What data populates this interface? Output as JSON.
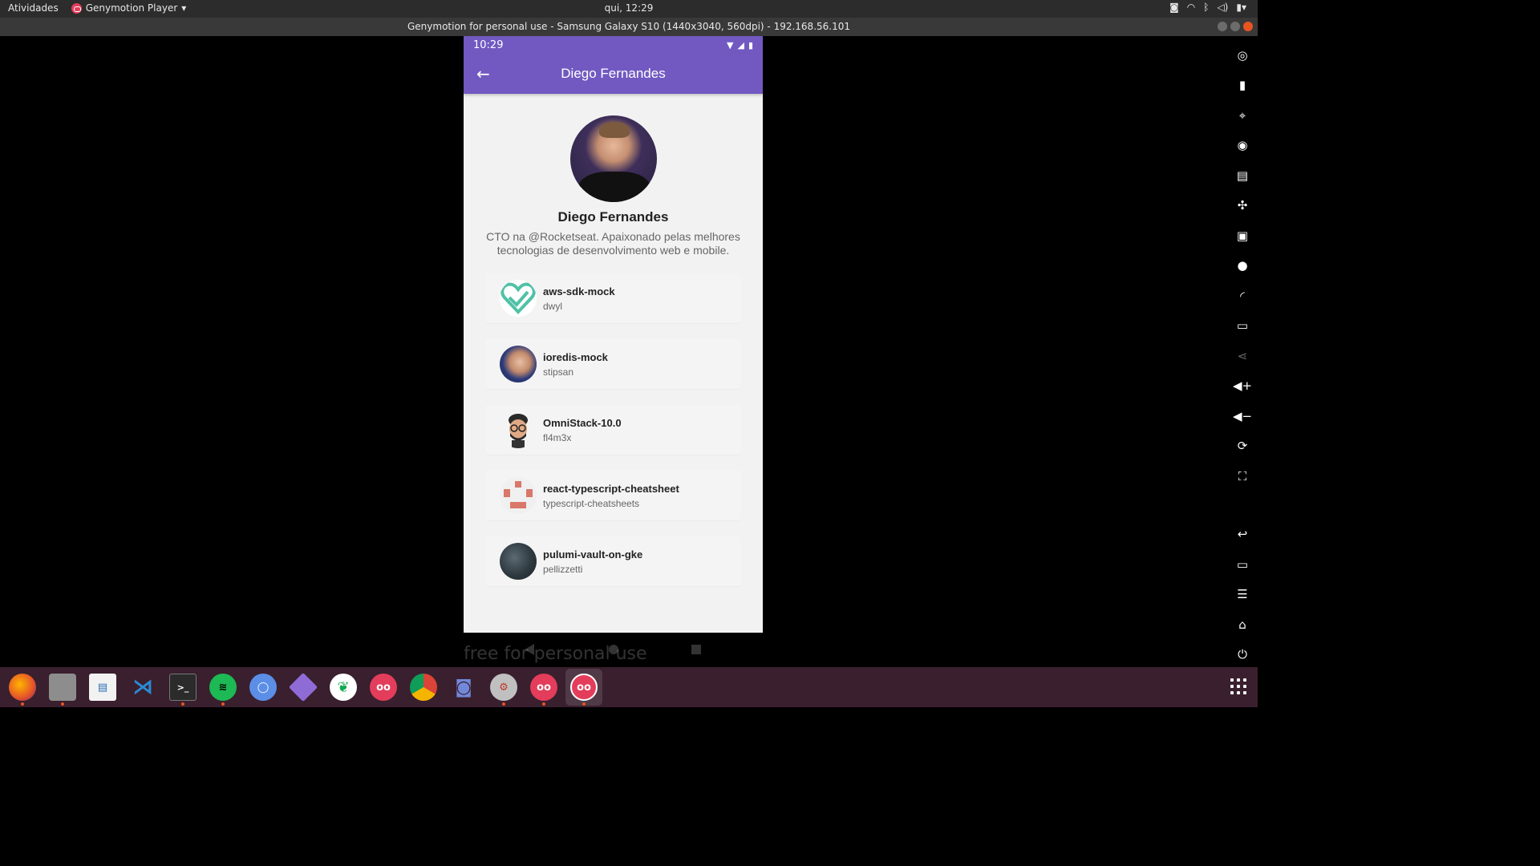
{
  "top_bar": {
    "activities": "Atividades",
    "app_menu": "Genymotion Player",
    "clock": "qui, 12:29"
  },
  "window": {
    "title": "Genymotion for personal use - Samsung Galaxy S10 (1440x3040, 560dpi) - 192.168.56.101"
  },
  "phone": {
    "status_time": "10:29",
    "appbar_title": "Diego Fernandes",
    "profile": {
      "name": "Diego Fernandes",
      "bio": "CTO na @Rocketseat. Apaixonado pelas melhores tecnologias de desenvolvimento web e mobile."
    },
    "repos": [
      {
        "title": "aws-sdk-mock",
        "owner": "dwyl",
        "avatar": "heart-logo"
      },
      {
        "title": "ioredis-mock",
        "owner": "stipsan",
        "avatar": "photo"
      },
      {
        "title": "OmniStack-10.0",
        "owner": "fl4m3x",
        "avatar": "memoji"
      },
      {
        "title": "react-typescript-cheatsheet",
        "owner": "typescript-cheatsheets",
        "avatar": "pixel-face"
      },
      {
        "title": "pulumi-vault-on-gke",
        "owner": "pellizzetti",
        "avatar": "photo"
      }
    ],
    "watermark": "free for personal use"
  },
  "colors": {
    "primary": "#7159c1",
    "heart": "#4fc1a6",
    "pixel": "#d9776a"
  }
}
